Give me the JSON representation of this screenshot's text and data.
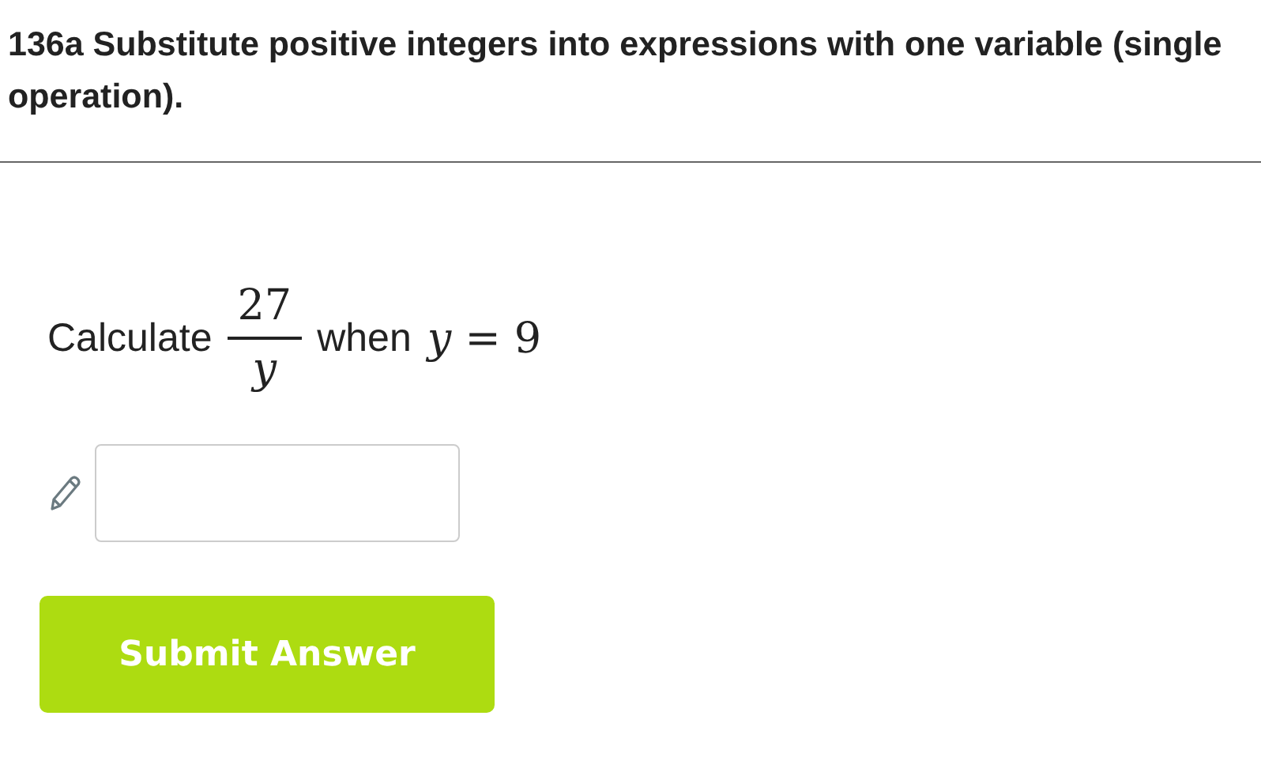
{
  "title": "136a Substitute positive integers into expressions with one variable (single operation).",
  "question": {
    "lead": "Calculate",
    "numerator": "27",
    "denominator": "y",
    "connector": "when",
    "equation": "*y* = 9"
  },
  "submit_button": "Submit Answer"
}
